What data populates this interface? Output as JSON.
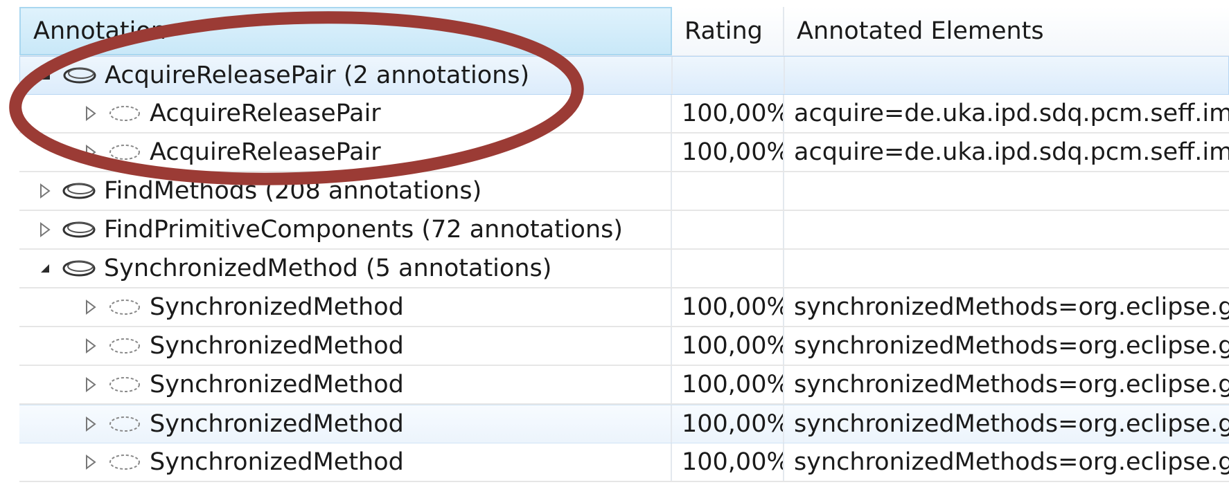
{
  "headers": {
    "annotation": "Annotation",
    "rating": "Rating",
    "elements": "Annotated Elements"
  },
  "colors": {
    "highlight_ring": "#9b3b35",
    "selection": "#dcecfb"
  },
  "rows": [
    {
      "level": 0,
      "expanded": true,
      "label": "AcquireReleasePair (2 annotations)",
      "rating": "",
      "elements": "",
      "icon": "group-ellipse-icon"
    },
    {
      "level": 1,
      "expanded": false,
      "label": "AcquireReleasePair",
      "rating": "100,00%",
      "elements": "acquire=de.uka.ipd.sdq.pcm.seff.imp",
      "icon": "item-ellipse-icon"
    },
    {
      "level": 1,
      "expanded": false,
      "label": "AcquireReleasePair",
      "rating": "100,00%",
      "elements": "acquire=de.uka.ipd.sdq.pcm.seff.imp",
      "icon": "item-ellipse-icon"
    },
    {
      "level": 0,
      "expanded": false,
      "label": "FindMethods (208 annotations)",
      "rating": "",
      "elements": "",
      "icon": "group-ellipse-icon"
    },
    {
      "level": 0,
      "expanded": false,
      "label": "FindPrimitiveComponents (72 annotations)",
      "rating": "",
      "elements": "",
      "icon": "group-ellipse-icon"
    },
    {
      "level": 0,
      "expanded": true,
      "label": "SynchronizedMethod (5 annotations)",
      "rating": "",
      "elements": "",
      "icon": "group-ellipse-icon"
    },
    {
      "level": 1,
      "expanded": false,
      "label": "SynchronizedMethod",
      "rating": "100,00%",
      "elements": "synchronizedMethods=org.eclipse.gi",
      "icon": "item-ellipse-icon"
    },
    {
      "level": 1,
      "expanded": false,
      "label": "SynchronizedMethod",
      "rating": "100,00%",
      "elements": "synchronizedMethods=org.eclipse.gi",
      "icon": "item-ellipse-icon"
    },
    {
      "level": 1,
      "expanded": false,
      "label": "SynchronizedMethod",
      "rating": "100,00%",
      "elements": "synchronizedMethods=org.eclipse.gi",
      "icon": "item-ellipse-icon"
    },
    {
      "level": 1,
      "expanded": false,
      "label": "SynchronizedMethod",
      "rating": "100,00%",
      "elements": "synchronizedMethods=org.eclipse.gi",
      "icon": "item-ellipse-icon"
    },
    {
      "level": 1,
      "expanded": false,
      "label": "SynchronizedMethod",
      "rating": "100,00%",
      "elements": "synchronizedMethods=org.eclipse.gi",
      "icon": "item-ellipse-icon"
    }
  ]
}
